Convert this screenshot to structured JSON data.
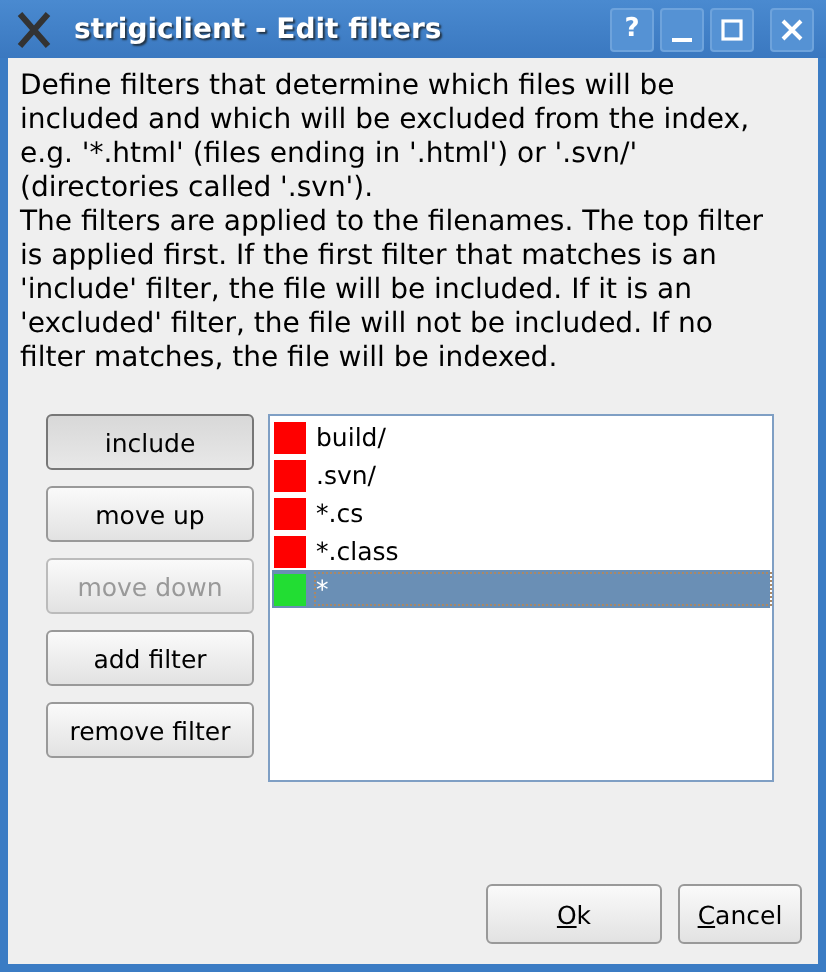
{
  "window": {
    "title": "strigiclient - Edit filters",
    "controls": [
      "?"
    ]
  },
  "description": [
    "Define filters that determine which files will be included and which will be excluded from the index, e.g. '*.html' (files ending in '.html') or '.svn/' (directories called '.svn').",
    "The filters are applied to the filenames. The top filter is applied first. If the first filter that matches is an 'include' filter, the file will be included. If it is an 'excluded' filter, the file will not be included. If no filter matches, the file will be indexed."
  ],
  "side_buttons": [
    {
      "label": "include",
      "pressed": true,
      "disabled": false
    },
    {
      "label": "move up",
      "pressed": false,
      "disabled": false
    },
    {
      "label": "move down",
      "pressed": false,
      "disabled": true
    },
    {
      "label": "add filter",
      "pressed": false,
      "disabled": false
    },
    {
      "label": "remove filter",
      "pressed": false,
      "disabled": false
    }
  ],
  "filters": [
    {
      "pattern": "build/",
      "color": "#ff0000",
      "selected": false
    },
    {
      "pattern": ".svn/",
      "color": "#ff0000",
      "selected": false
    },
    {
      "pattern": "*.cs",
      "color": "#ff0000",
      "selected": false
    },
    {
      "pattern": "*.class",
      "color": "#ff0000",
      "selected": false
    },
    {
      "pattern": "*",
      "color": "#22dd33",
      "selected": true
    }
  ],
  "dialog_buttons": [
    {
      "label": "Ok",
      "mnemonic_underlined": true
    },
    {
      "label": "Cancel",
      "mnemonic_underlined": true
    }
  ]
}
